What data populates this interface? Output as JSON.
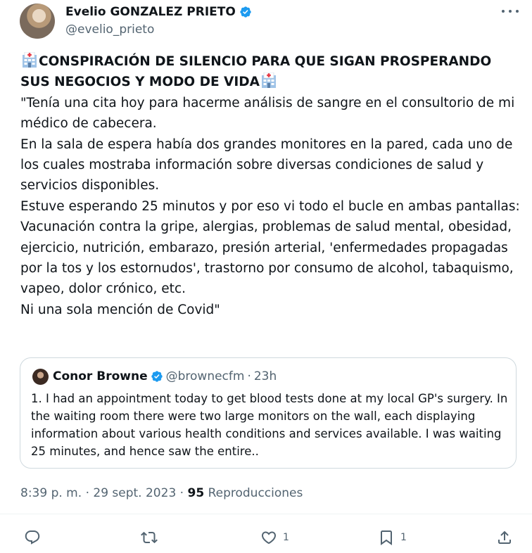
{
  "author": {
    "name": "Evelio GONZALEZ PRIETO",
    "handle": "@evelio_prieto",
    "avatar_icon": "profile-photo"
  },
  "tweet": {
    "headline": "CONSPIRACIÓN DE SILENCIO PARA QUE SIGAN PROSPERANDO SUS NEGOCIOS Y MODO DE VIDA",
    "paragraphs": [
      "\"Tenía una cita hoy para hacerme análisis de sangre en el consultorio de mi médico de cabecera.",
      "En la sala de espera había dos grandes monitores en la pared, cada uno de los cuales mostraba información sobre diversas condiciones de salud y servicios disponibles.",
      "Estuve esperando 25 minutos y por eso vi todo el bucle en ambas pantallas:",
      "Vacunación contra la gripe, alergias, problemas de salud mental, obesidad, ejercicio, nutrición, embarazo, presión arterial, 'enfermedades propagadas por la tos y los estornudos', trastorno por consumo de alcohol, tabaquismo, vapeo, dolor crónico, etc.",
      "Ni una sola mención de Covid\""
    ]
  },
  "quote": {
    "name": "Conor Browne",
    "handle": "@brownecfm",
    "separator": "·",
    "time": "23h",
    "text": "1. I had an appointment today to get blood tests done at my local GP's surgery. In the waiting room there were two large monitors on the wall, each displaying information about various health conditions and services available. I was waiting 25 minutes, and hence saw the entire.."
  },
  "meta": {
    "time": "8:39 p. m.",
    "sep1": "·",
    "date": "29 sept. 2023",
    "sep2": "·",
    "views": "95",
    "views_label": "Reproducciones"
  },
  "actions": {
    "reply_count": "",
    "retweet_count": "",
    "like_count": "1",
    "bookmark_count": "1"
  },
  "colors": {
    "verified": "#1d9bf0",
    "text": "#0f1419",
    "secondary": "#536471",
    "border": "#cfd9de"
  }
}
